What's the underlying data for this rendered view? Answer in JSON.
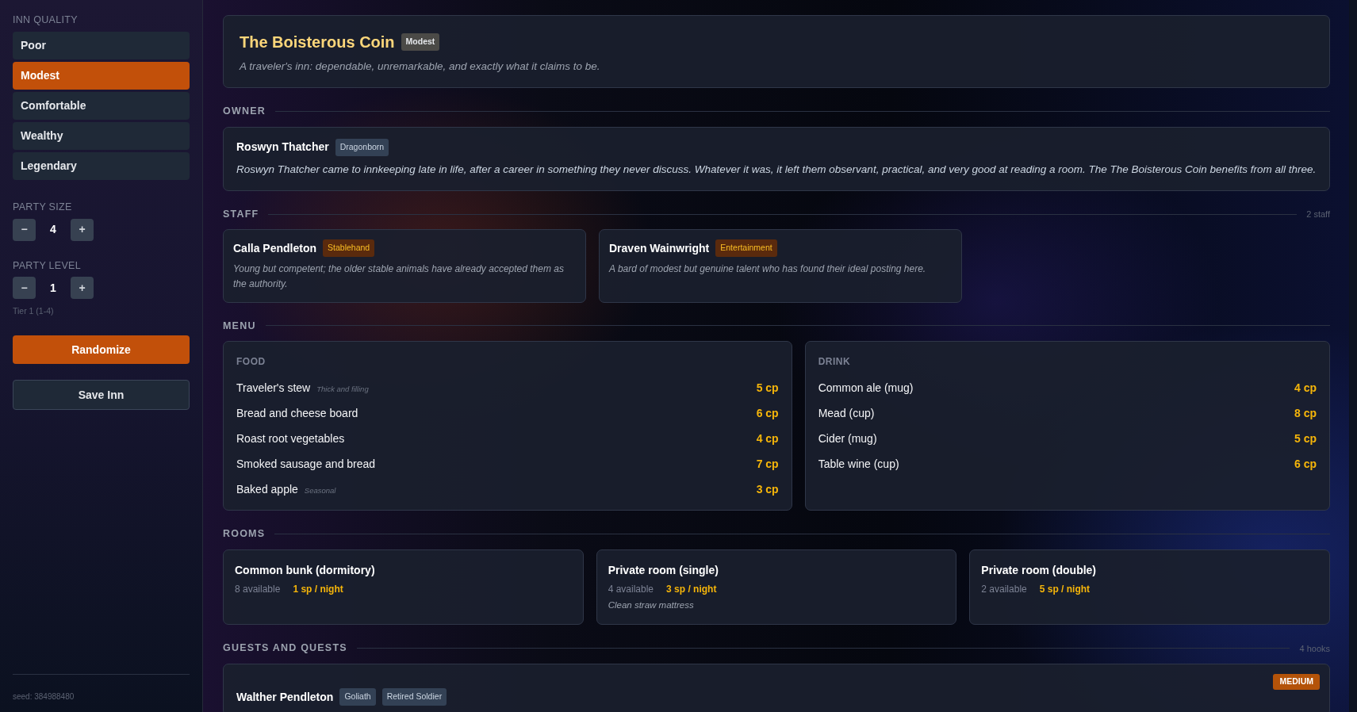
{
  "sidebar": {
    "quality_label": "INN QUALITY",
    "quality_options": [
      {
        "label": "Poor",
        "selected": false
      },
      {
        "label": "Modest",
        "selected": true
      },
      {
        "label": "Comfortable",
        "selected": false
      },
      {
        "label": "Wealthy",
        "selected": false
      },
      {
        "label": "Legendary",
        "selected": false
      }
    ],
    "party_size": {
      "label": "PARTY SIZE",
      "decrement": "−",
      "value": "4",
      "increment": "+"
    },
    "party_level": {
      "label": "PARTY LEVEL",
      "decrement": "−",
      "value": "1",
      "increment": "+",
      "tier": "Tier 1 (1-4)"
    },
    "randomize_button": "Randomize",
    "save_button": "Save Inn",
    "seed": "seed: 384988480"
  },
  "header": {
    "title": "The Boisterous Coin",
    "badge": "Modest",
    "tagline": "A traveler's inn: dependable, unremarkable, and exactly what it claims to be."
  },
  "owner": {
    "heading": "OWNER",
    "name": "Roswyn Thatcher",
    "race": "Dragonborn",
    "bio": "Roswyn Thatcher came to innkeeping late in life, after a career in something they never discuss. Whatever it was, it left them observant, practical, and very good at reading a room. The The Boisterous Coin benefits from all three."
  },
  "staff": {
    "heading": "STAFF",
    "count": "2 staff",
    "members": [
      {
        "name": "Calla Pendleton",
        "role": "Stablehand",
        "bio": "Young but competent; the older stable animals have already accepted them as the authority."
      },
      {
        "name": "Draven Wainwright",
        "role": "Entertainment",
        "bio": "A bard of modest but genuine talent who has found their ideal posting here."
      }
    ]
  },
  "menu": {
    "heading": "MENU",
    "sections": [
      {
        "title": "FOOD",
        "items": [
          {
            "name": "Traveler's stew",
            "note": "Thick and filling",
            "price": "5 cp"
          },
          {
            "name": "Bread and cheese board",
            "price": "6 cp"
          },
          {
            "name": "Roast root vegetables",
            "price": "4 cp"
          },
          {
            "name": "Smoked sausage and bread",
            "price": "7 cp"
          },
          {
            "name": "Baked apple",
            "note": "Seasonal",
            "price": "3 cp"
          }
        ]
      },
      {
        "title": "DRINK",
        "items": [
          {
            "name": "Common ale (mug)",
            "price": "4 cp"
          },
          {
            "name": "Mead (cup)",
            "price": "8 cp"
          },
          {
            "name": "Cider (mug)",
            "price": "5 cp"
          },
          {
            "name": "Table wine (cup)",
            "price": "6 cp"
          }
        ]
      }
    ]
  },
  "rooms": {
    "heading": "ROOMS",
    "items": [
      {
        "name": "Common bunk (dormitory)",
        "available": "8 available",
        "price": "1 sp / night"
      },
      {
        "name": "Private room (single)",
        "available": "4 available",
        "price": "3 sp / night",
        "note": "Clean straw mattress"
      },
      {
        "name": "Private room (double)",
        "available": "2 available",
        "price": "5 sp / night"
      }
    ]
  },
  "guests": {
    "heading": "GUESTS AND QUESTS",
    "count": "4 hooks",
    "hooks": [
      {
        "name": "Walther Pendleton",
        "tags": [
          "Goliath",
          "Retired Soldier"
        ],
        "difficulty": "MEDIUM"
      }
    ]
  }
}
